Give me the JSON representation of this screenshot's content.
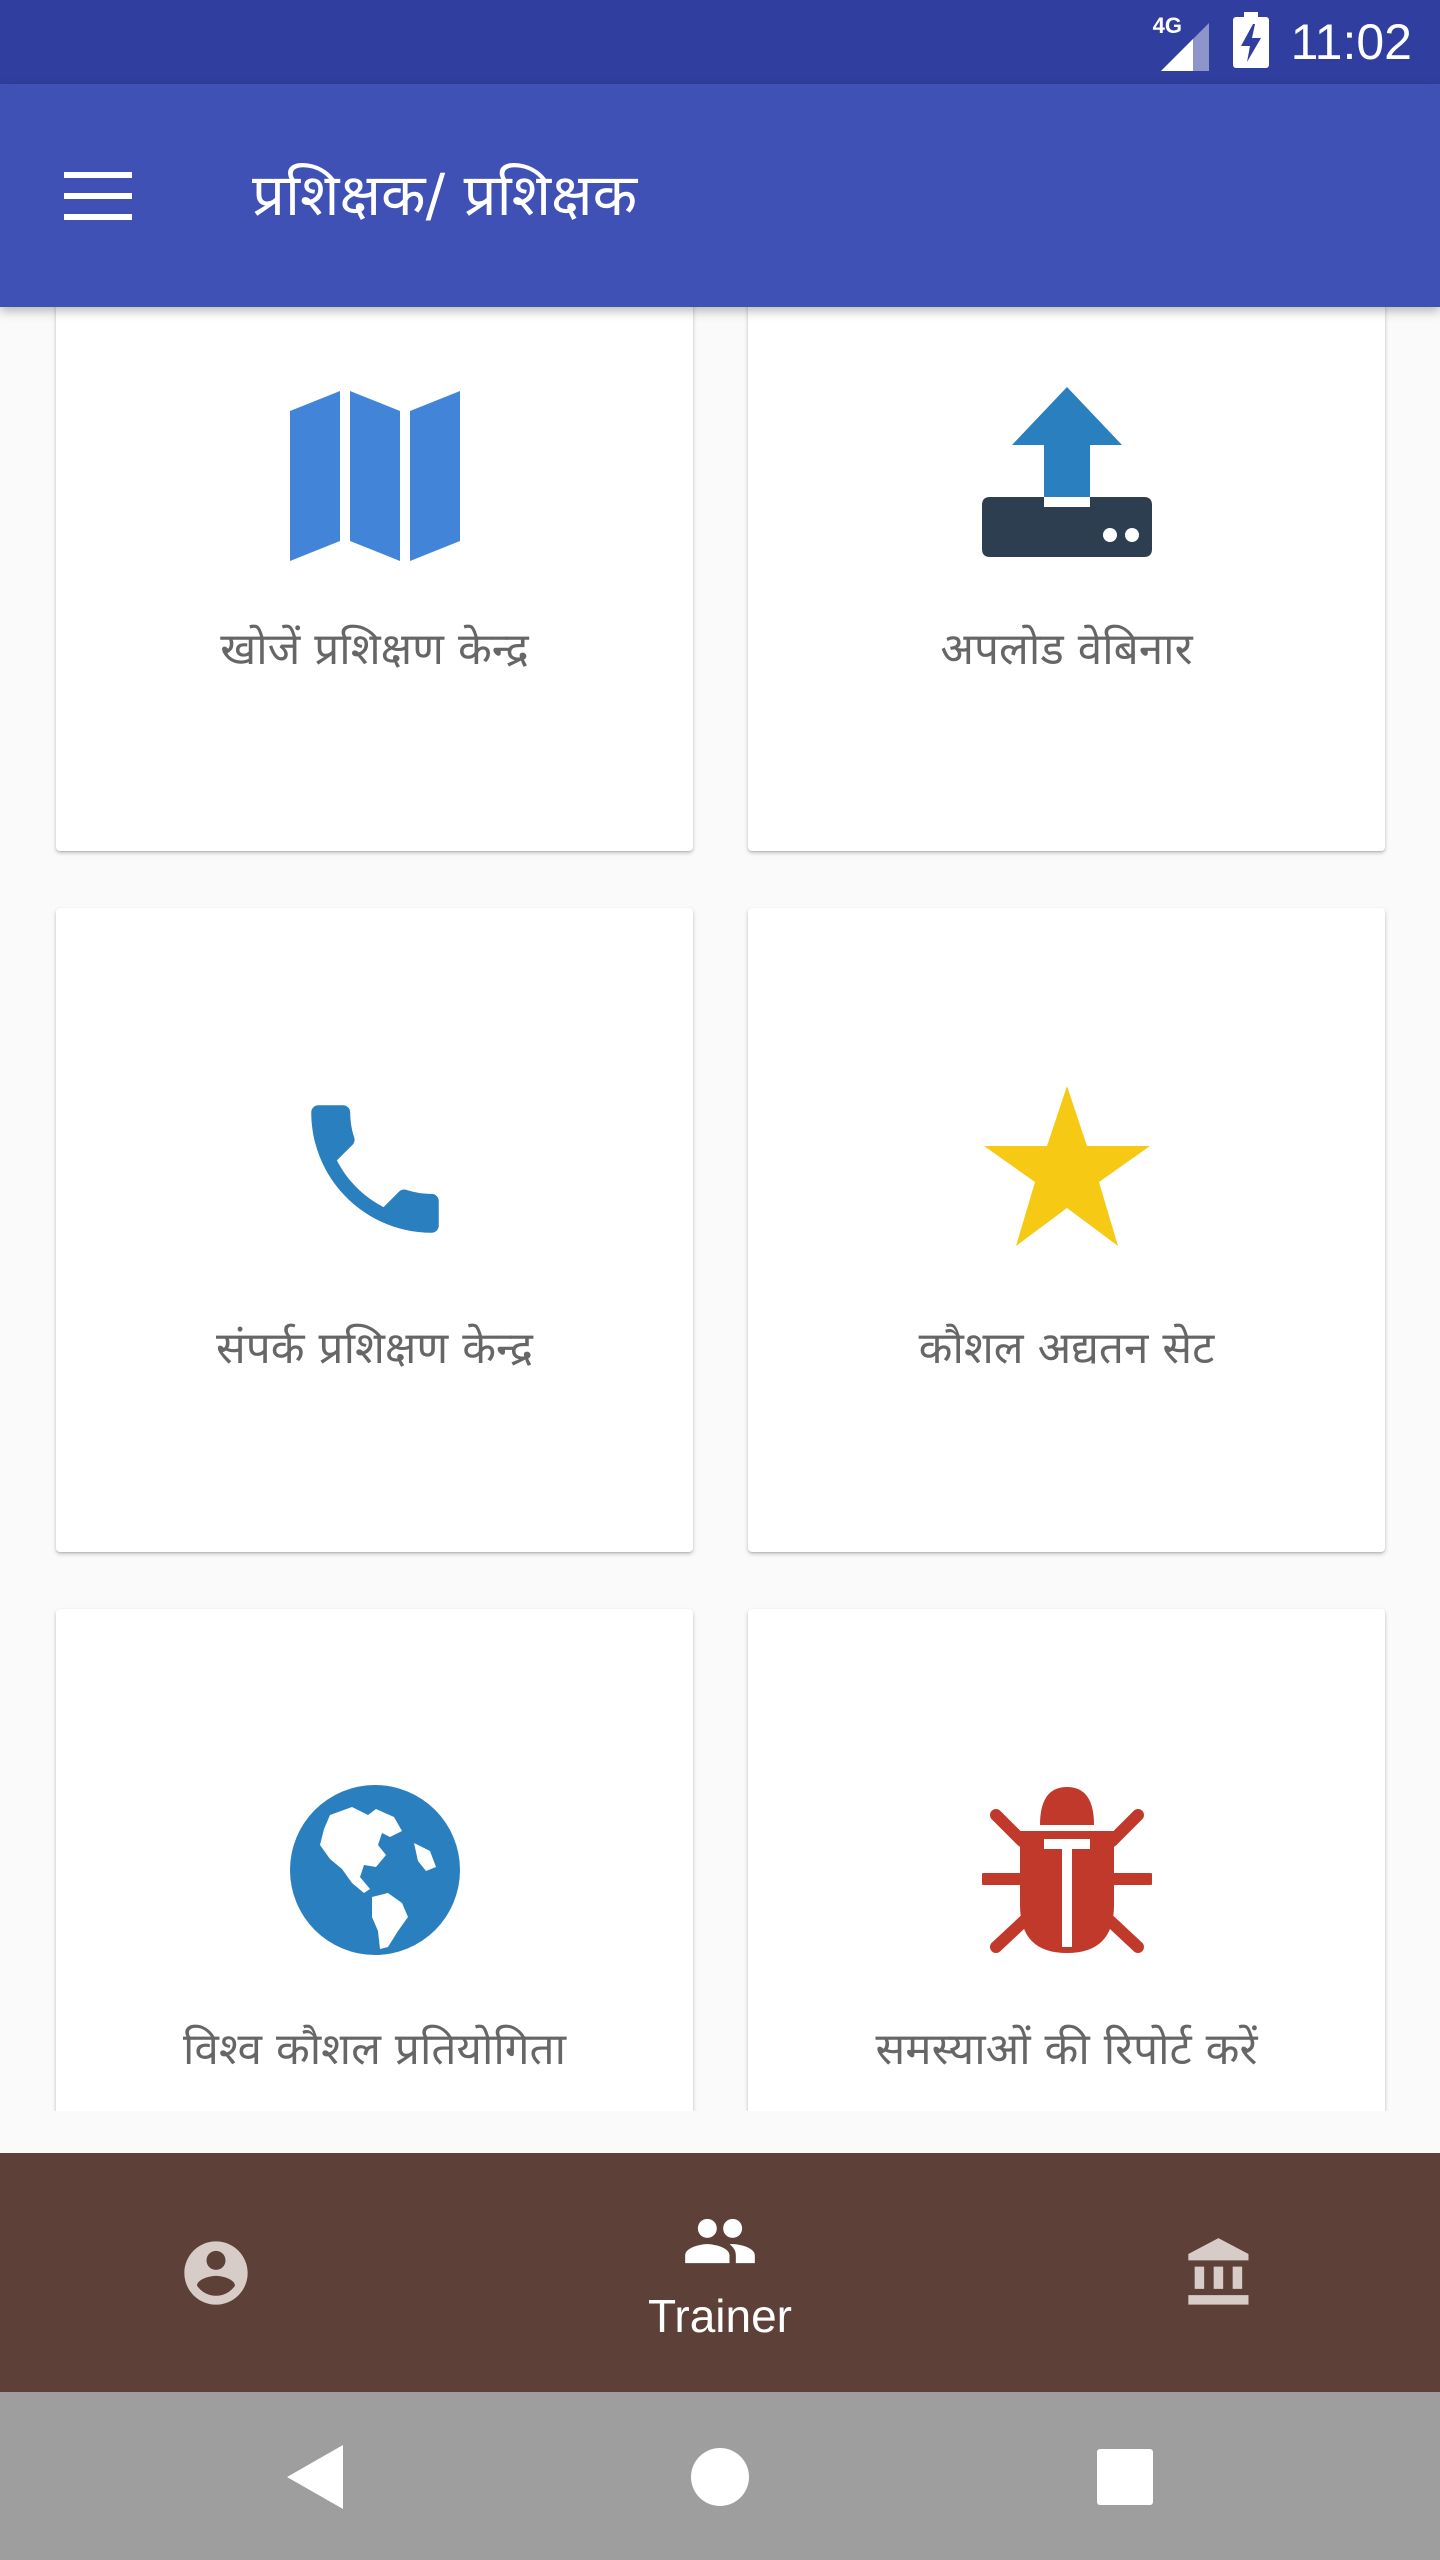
{
  "status_bar": {
    "time": "11:02",
    "network": "4G"
  },
  "app_bar": {
    "title": "प्रशिक्षक/ प्रशिक्षक"
  },
  "cards": [
    {
      "label": "खोजें प्रशिक्षण केन्द्र",
      "icon": "map-icon",
      "color": "#4285d8"
    },
    {
      "label": "अपलोड वेबिनार",
      "icon": "upload-icon",
      "color": "#2a7fbf"
    },
    {
      "label": "संपर्क प्रशिक्षण केन्द्र",
      "icon": "phone-icon",
      "color": "#2a7fbf"
    },
    {
      "label": "कौशल अद्यतन सेट",
      "icon": "star-icon",
      "color": "#f6c915"
    },
    {
      "label": "विश्व कौशल प्रतियोगिता",
      "icon": "globe-icon",
      "color": "#2a7fbf"
    },
    {
      "label": "समस्याओं की रिपोर्ट करें",
      "icon": "bug-icon",
      "color": "#c0392b"
    }
  ],
  "bottom_nav": {
    "items": [
      {
        "icon": "account-icon",
        "label": ""
      },
      {
        "icon": "people-icon",
        "label": "Trainer",
        "active": true
      },
      {
        "icon": "institution-icon",
        "label": ""
      }
    ]
  },
  "colors": {
    "status_bar": "#303f9f",
    "app_bar": "#3f51b5",
    "bottom_nav": "#5d4037",
    "system_nav": "#9e9e9e"
  }
}
